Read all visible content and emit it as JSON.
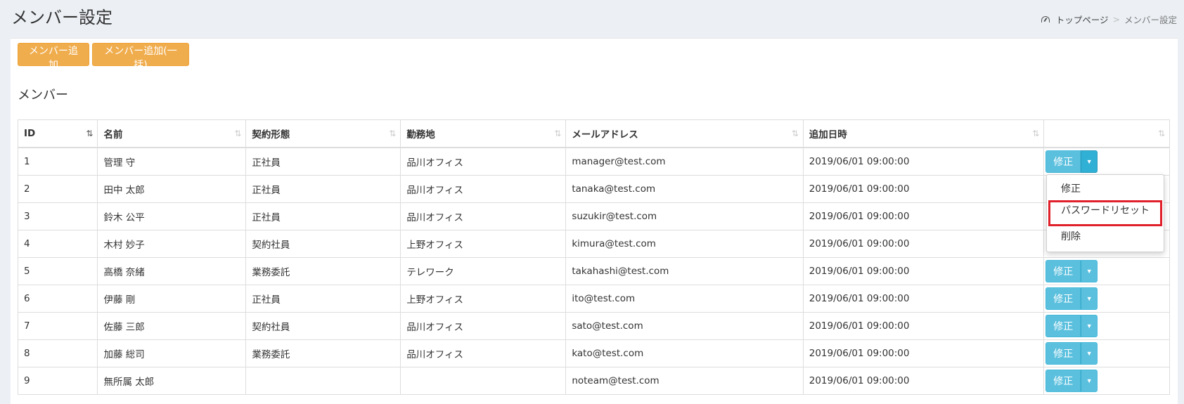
{
  "page": {
    "title": "メンバー設定",
    "breadcrumb": {
      "home": "トップページ",
      "separator": ">",
      "current": "メンバー設定"
    }
  },
  "toolbar": {
    "add_label": "メンバー追加",
    "bulk_add_label": "メンバー追加(一括)"
  },
  "section": {
    "title": "メンバー"
  },
  "table": {
    "headers": [
      "ID",
      "名前",
      "契約形態",
      "勤務地",
      "メールアドレス",
      "追加日時",
      ""
    ],
    "sort_icon": "⇅",
    "rows": [
      [
        "1",
        "管理 守",
        "正社員",
        "品川オフィス",
        "manager@test.com",
        "2019/06/01 09:00:00"
      ],
      [
        "2",
        "田中 太郎",
        "正社員",
        "品川オフィス",
        "tanaka@test.com",
        "2019/06/01 09:00:00"
      ],
      [
        "3",
        "鈴木 公平",
        "正社員",
        "品川オフィス",
        "suzukir@test.com",
        "2019/06/01 09:00:00"
      ],
      [
        "4",
        "木村 妙子",
        "契約社員",
        "上野オフィス",
        "kimura@test.com",
        "2019/06/01 09:00:00"
      ],
      [
        "5",
        "高橋 奈緒",
        "業務委託",
        "テレワーク",
        "takahashi@test.com",
        "2019/06/01 09:00:00"
      ],
      [
        "6",
        "伊藤 剛",
        "正社員",
        "上野オフィス",
        "ito@test.com",
        "2019/06/01 09:00:00"
      ],
      [
        "7",
        "佐藤 三郎",
        "契約社員",
        "品川オフィス",
        "sato@test.com",
        "2019/06/01 09:00:00"
      ],
      [
        "8",
        "加藤 総司",
        "業務委託",
        "品川オフィス",
        "kato@test.com",
        "2019/06/01 09:00:00"
      ],
      [
        "9",
        "無所属 太郎",
        "",
        "",
        "noteam@test.com",
        "2019/06/01 09:00:00"
      ]
    ],
    "edit_label": "修正",
    "rows_with_button": [
      0,
      4,
      5,
      6,
      7,
      8
    ]
  },
  "dropdown": {
    "items": [
      "修正",
      "パスワードリセット",
      "削除"
    ],
    "highlighted_index": 1
  },
  "colors": {
    "warning": "#f0ad4e",
    "info": "#5bc0de",
    "highlight_border": "#e0202a",
    "background": "#ecf0f5"
  }
}
